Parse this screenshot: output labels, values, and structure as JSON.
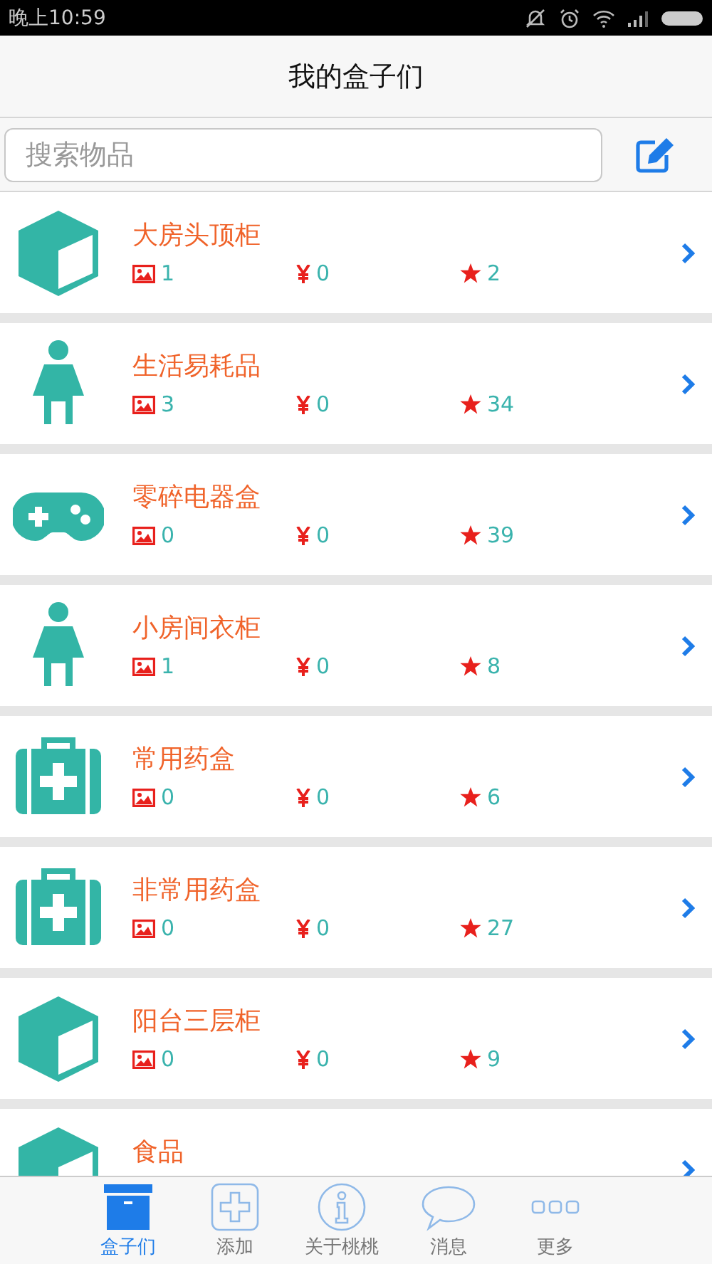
{
  "status_bar": {
    "time": "晚上10:59"
  },
  "header": {
    "title": "我的盒子们"
  },
  "search": {
    "placeholder": "搜索物品"
  },
  "boxes": [
    {
      "kind": "box",
      "name": "大房头顶柜",
      "photos": "1",
      "price": "0",
      "stars_count": "2"
    },
    {
      "kind": "person",
      "name": "生活易耗品",
      "photos": "3",
      "price": "0",
      "stars_count": "34"
    },
    {
      "kind": "gamepad",
      "name": "零碎电器盒",
      "photos": "0",
      "price": "0",
      "stars_count": "39"
    },
    {
      "kind": "person",
      "name": "小房间衣柜",
      "photos": "1",
      "price": "0",
      "stars_count": "8"
    },
    {
      "kind": "medkit",
      "name": "常用药盒",
      "photos": "0",
      "price": "0",
      "stars_count": "6"
    },
    {
      "kind": "medkit",
      "name": "非常用药盒",
      "photos": "0",
      "price": "0",
      "stars_count": "27"
    },
    {
      "kind": "box",
      "name": "阳台三层柜",
      "photos": "0",
      "price": "0",
      "stars_count": "9"
    },
    {
      "kind": "box",
      "name": "食品"
    }
  ],
  "tabs": [
    {
      "kind": "box",
      "label": "盒子们",
      "selected": true
    },
    {
      "kind": "plus",
      "label": "添加",
      "selected": false
    },
    {
      "kind": "info",
      "label": "关于桃桃",
      "selected": false
    },
    {
      "kind": "chat",
      "label": "消息",
      "selected": false
    },
    {
      "kind": "more",
      "label": "更多",
      "selected": false
    }
  ]
}
